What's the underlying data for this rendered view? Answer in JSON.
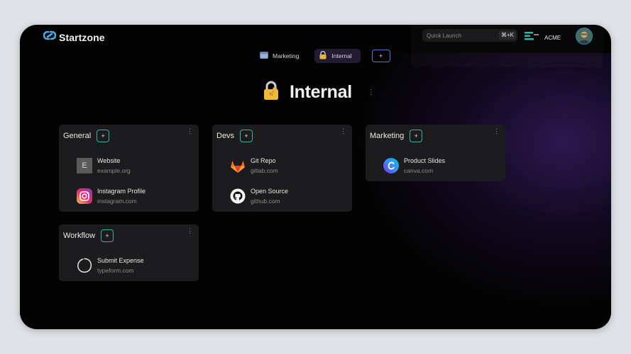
{
  "app": {
    "name": "Startzone"
  },
  "search": {
    "placeholder": "Quick Launch",
    "shortcut": "⌘+K"
  },
  "org": {
    "name": "ACME"
  },
  "tabs": [
    {
      "label": "Marketing",
      "icon": "window-icon",
      "active": false
    },
    {
      "label": "Internal",
      "icon": "lock-key-icon",
      "active": true
    }
  ],
  "tab_add_label": "+",
  "page": {
    "title": "Internal",
    "icon": "lock-key-icon"
  },
  "groups": [
    {
      "title": "General",
      "links": [
        {
          "name": "Website",
          "url": "example.org",
          "icon": "letter-e-icon",
          "icon_text": "E"
        },
        {
          "name": "Instagram Profile",
          "url": "instagram.com",
          "icon": "instagram-icon"
        }
      ]
    },
    {
      "title": "Devs",
      "links": [
        {
          "name": "Git Repo",
          "url": "gitlab.com",
          "icon": "gitlab-icon"
        },
        {
          "name": "Open Source",
          "url": "github.com",
          "icon": "github-icon"
        }
      ]
    },
    {
      "title": "Marketing",
      "links": [
        {
          "name": "Product Slides",
          "url": "canva.com",
          "icon": "canva-icon"
        }
      ]
    },
    {
      "title": "Workflow",
      "links": [
        {
          "name": "Submit Expense",
          "url": "typeform.com",
          "icon": "typeform-icon"
        }
      ]
    }
  ],
  "group_add_label": "+",
  "colors": {
    "accent_teal": "#2fb5a4",
    "accent_blue": "#4c7bd1",
    "active_tab": "#221b33",
    "card": "#1c1c1e"
  }
}
